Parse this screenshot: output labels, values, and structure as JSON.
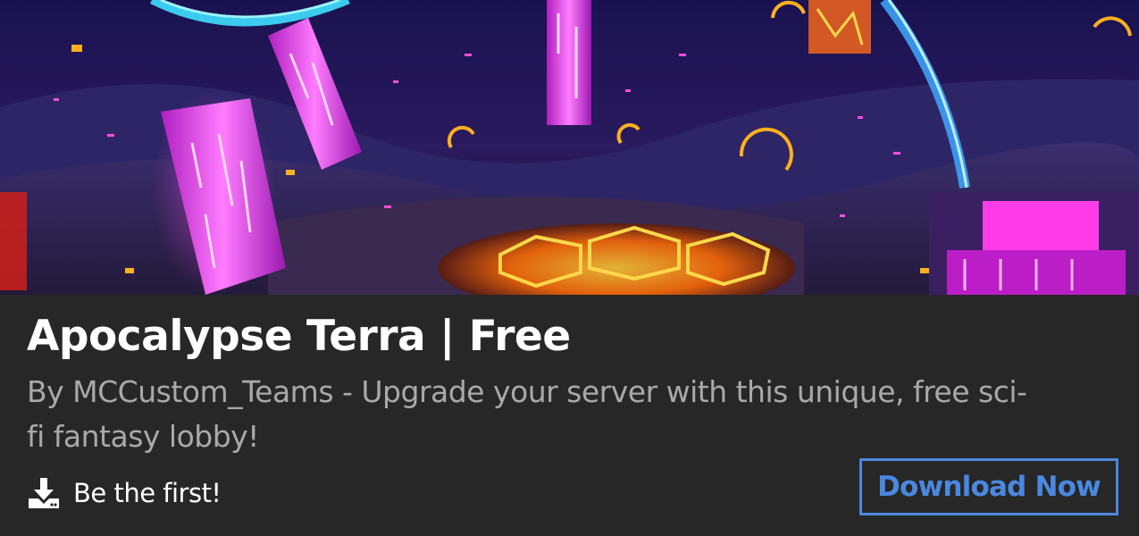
{
  "banner": {
    "image": "voxel sci-fi fantasy lobby with glowing magenta crystal towers, neon blue arch and lava hexagon floor"
  },
  "title": "Apocalypse Terra | Free",
  "subtitle": "By MCCustom_Teams - Upgrade your server with this unique, free sci-fi fantasy lobby!",
  "stats": {
    "icon": "download-icon",
    "label": "Be the first!"
  },
  "actions": {
    "download_label": "Download Now"
  },
  "colors": {
    "background": "#272727",
    "title": "#ffffff",
    "subtitle": "#a9a9a9",
    "accent": "#4a88e0"
  }
}
